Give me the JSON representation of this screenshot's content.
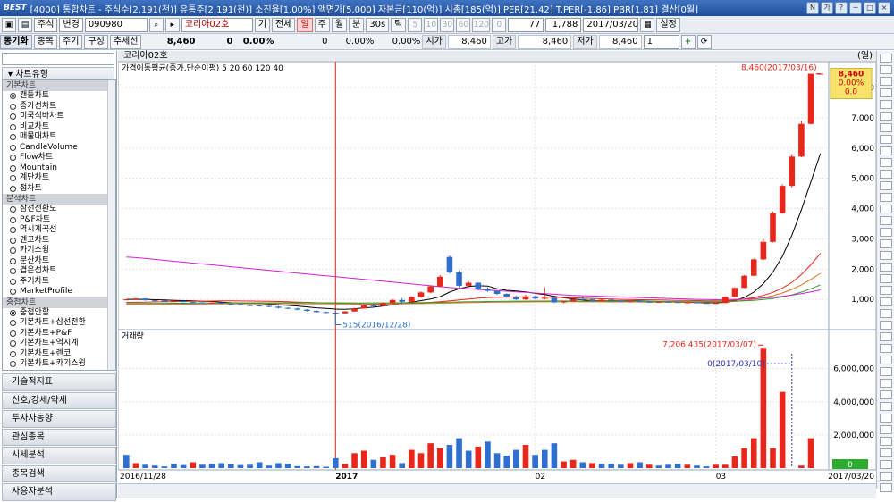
{
  "titlebar": {
    "logo": "BEST",
    "title": "[4000] 통합차트 - 주식수[2,191(천)] 유통주[2,191(천)] 소진율[1.00%] 액면가[5,000] 자본금[110(억)] 시총[185(억)] PER[21.42] T.PER[-1.86] PBR[1.81] 결산[0월]",
    "buttons": [
      "N",
      "가",
      "?",
      "─",
      "□",
      "×"
    ]
  },
  "toolbar": {
    "market": "주식",
    "change_label": "변경",
    "code": "090980",
    "stock_name": "코리아02호",
    "period_buttons": [
      "기",
      "전체",
      "일",
      "주",
      "월",
      "분",
      "30s",
      "틱"
    ],
    "interval_values": [
      "5",
      "10",
      "30",
      "60",
      "120",
      "0"
    ],
    "count": "77",
    "total": "1,788",
    "date": "2017/03/20",
    "settings_label": "설정"
  },
  "quote_row": {
    "link_label": "동기화",
    "tabs": [
      "종목",
      "주기",
      "구성",
      "추세선"
    ],
    "price": "8,460",
    "change": "0",
    "change_pct": "0.00%",
    "volume": "0",
    "vol_pct": "0.00%",
    "vol_pct2": "0.00%",
    "open_label": "시가",
    "open": "8,460",
    "high_label": "고가",
    "high": "8,460",
    "low_label": "저가",
    "low": "8,460",
    "combo_value": "1"
  },
  "left_panel": {
    "header": "차트유형",
    "groups": [
      {
        "name": "기본차트",
        "items": [
          "캔들차트",
          "종가선차트",
          "미국식바차트",
          "비교차트",
          "매물대차트",
          "CandleVolume",
          "Flow차트",
          "Mountain",
          "계단차트",
          "점차트"
        ],
        "selected": 0
      },
      {
        "name": "분석차트",
        "items": [
          "삼선전환도",
          "P&F차트",
          "역시계곡선",
          "렌코차트",
          "카기스윙",
          "분산차트",
          "겹은선차트",
          "주기차트",
          "MarketProfile"
        ],
        "selected": -1
      },
      {
        "name": "중첩차트",
        "items": [
          "중첩안함",
          "기본차트+삼선전환",
          "기본차트+P&F",
          "기본차트+역시계",
          "기본차트+렌코",
          "기본차트+카기스윙"
        ],
        "selected": 0
      }
    ],
    "menu": [
      "기술적지표",
      "신호/강세/약세",
      "투자자동향",
      "관심종목",
      "시세분석",
      "종목검색",
      "사용자분석"
    ]
  },
  "chart_header": {
    "name": "코리아02호",
    "unit": "(일)"
  },
  "colors": {
    "up": "#e8261a",
    "down": "#2f6fcf",
    "ma5": "#000000",
    "ma20": "#e8261a",
    "ma60": "#2e9e2e",
    "ma120": "#d020d0",
    "ma40": "#e07020"
  },
  "chart_data": [
    {
      "type": "candlestick",
      "title": "가격이동평균(종가,단순이평) 5 20 60 120 40",
      "legend": [
        "5",
        "20",
        "60",
        "120",
        "40"
      ],
      "x_ticks": [
        "2016/11/28",
        "2017",
        "02",
        "03",
        "2017/03/20"
      ],
      "ylim": [
        0,
        8800
      ],
      "y_ticks": [
        1000,
        2000,
        3000,
        4000,
        5000,
        6000,
        7000,
        8000
      ],
      "y_tick_labels": [
        "1,000",
        "2,000",
        "3,000",
        "4,000",
        "5,000",
        "6,000",
        "7,000",
        "8,000"
      ],
      "current_price": "8,460",
      "current_change": "0.00%",
      "current_diff": "0.0",
      "annotations": [
        {
          "text": "8,460(2017/03/16)",
          "index": 73,
          "value": 8460
        },
        {
          "text": "515(2016/12/28)",
          "index": 22,
          "value": 515
        }
      ],
      "candles": [
        [
          1000,
          1000,
          1000,
          1000
        ],
        [
          1000,
          1050,
          980,
          1030
        ],
        [
          1030,
          1040,
          960,
          970
        ],
        [
          970,
          990,
          940,
          960
        ],
        [
          960,
          980,
          930,
          940
        ],
        [
          940,
          960,
          920,
          950
        ],
        [
          950,
          960,
          900,
          910
        ],
        [
          910,
          930,
          880,
          900
        ],
        [
          900,
          910,
          870,
          880
        ],
        [
          880,
          900,
          860,
          890
        ],
        [
          890,
          900,
          850,
          860
        ],
        [
          860,
          880,
          830,
          840
        ],
        [
          840,
          850,
          800,
          810
        ],
        [
          810,
          830,
          780,
          800
        ],
        [
          800,
          820,
          760,
          780
        ],
        [
          780,
          800,
          740,
          760
        ],
        [
          760,
          780,
          700,
          720
        ],
        [
          720,
          740,
          680,
          700
        ],
        [
          700,
          720,
          640,
          660
        ],
        [
          660,
          680,
          600,
          620
        ],
        [
          620,
          640,
          560,
          580
        ],
        [
          580,
          600,
          540,
          560
        ],
        [
          560,
          600,
          515,
          540
        ],
        [
          540,
          620,
          530,
          600
        ],
        [
          600,
          720,
          590,
          700
        ],
        [
          700,
          820,
          690,
          800
        ],
        [
          800,
          860,
          760,
          780
        ],
        [
          780,
          900,
          770,
          880
        ],
        [
          880,
          1000,
          860,
          980
        ],
        [
          980,
          1050,
          900,
          920
        ],
        [
          920,
          1100,
          900,
          1080
        ],
        [
          1080,
          1260,
          1050,
          1230
        ],
        [
          1230,
          1450,
          1200,
          1430
        ],
        [
          1430,
          1800,
          1400,
          1750
        ],
        [
          2400,
          2450,
          1850,
          1900
        ],
        [
          1900,
          1950,
          1400,
          1450
        ],
        [
          1450,
          1600,
          1380,
          1550
        ],
        [
          1550,
          1560,
          1300,
          1330
        ],
        [
          1330,
          1400,
          1250,
          1280
        ],
        [
          1280,
          1300,
          1150,
          1180
        ],
        [
          1180,
          1200,
          1050,
          1080
        ],
        [
          1080,
          1120,
          980,
          1000
        ],
        [
          1000,
          1150,
          980,
          1100
        ],
        [
          1100,
          1120,
          1000,
          1030
        ],
        [
          1030,
          1400,
          1000,
          1050
        ],
        [
          1050,
          1080,
          880,
          900
        ],
        [
          900,
          960,
          870,
          940
        ],
        [
          940,
          1030,
          920,
          1010
        ],
        [
          1010,
          1100,
          980,
          1000
        ],
        [
          1000,
          1020,
          920,
          940
        ],
        [
          940,
          1000,
          930,
          990
        ],
        [
          990,
          1000,
          940,
          960
        ],
        [
          960,
          980,
          920,
          930
        ],
        [
          930,
          960,
          900,
          950
        ],
        [
          950,
          970,
          910,
          920
        ],
        [
          920,
          940,
          880,
          900
        ],
        [
          900,
          930,
          890,
          920
        ],
        [
          920,
          940,
          900,
          910
        ],
        [
          910,
          930,
          880,
          890
        ],
        [
          890,
          910,
          870,
          900
        ],
        [
          900,
          920,
          870,
          880
        ],
        [
          880,
          900,
          860,
          870
        ],
        [
          870,
          890,
          850,
          880
        ],
        [
          880,
          1100,
          870,
          1090
        ],
        [
          1090,
          1400,
          1080,
          1380
        ],
        [
          1380,
          1800,
          1370,
          1780
        ],
        [
          1780,
          2350,
          1770,
          2320
        ],
        [
          2320,
          3000,
          2300,
          2900
        ],
        [
          2900,
          3900,
          2880,
          3850
        ],
        [
          3850,
          4800,
          3830,
          4750
        ],
        [
          4750,
          5800,
          4700,
          5720
        ],
        [
          5720,
          6900,
          5700,
          6800
        ],
        [
          6800,
          8460,
          6780,
          8460
        ],
        [
          8460,
          8460,
          8460,
          8460
        ]
      ],
      "ma": {
        "5": [
          1000,
          1000,
          1000,
          990,
          980,
          970,
          960,
          950,
          940,
          930,
          910,
          890,
          880,
          870,
          860,
          840,
          820,
          800,
          780,
          750,
          720,
          700,
          680,
          670,
          690,
          720,
          740,
          780,
          820,
          870,
          910,
          960,
          1010,
          1090,
          1240,
          1350,
          1430,
          1450,
          1440,
          1350,
          1300,
          1280,
          1250,
          1200,
          1160,
          1100,
          1050,
          1020,
          980,
          960,
          950,
          950,
          950,
          950,
          950,
          940,
          930,
          920,
          910,
          900,
          895,
          890,
          885,
          900,
          960,
          1060,
          1240,
          1520,
          1900,
          2420,
          3120,
          3960,
          4880,
          5820
        ],
        "20": [
          900,
          905,
          910,
          915,
          920,
          925,
          930,
          935,
          940,
          945,
          950,
          950,
          948,
          945,
          942,
          938,
          930,
          920,
          910,
          900,
          890,
          880,
          870,
          860,
          850,
          845,
          842,
          845,
          850,
          860,
          870,
          885,
          900,
          920,
          950,
          980,
          1010,
          1040,
          1060,
          1070,
          1075,
          1080,
          1080,
          1078,
          1075,
          1070,
          1060,
          1050,
          1040,
          1030,
          1020,
          1010,
          1000,
          995,
          990,
          985,
          980,
          975,
          970,
          965,
          960,
          955,
          950,
          955,
          975,
          1010,
          1060,
          1130,
          1230,
          1370,
          1560,
          1820,
          2140,
          2520
        ],
        "60": [
          860,
          862,
          864,
          866,
          868,
          870,
          872,
          874,
          876,
          878,
          880,
          882,
          883,
          884,
          885,
          886,
          887,
          888,
          888,
          888,
          887,
          886,
          885,
          884,
          883,
          882,
          882,
          883,
          885,
          887,
          890,
          893,
          897,
          902,
          908,
          914,
          920,
          925,
          930,
          934,
          938,
          941,
          943,
          945,
          946,
          947,
          947,
          947,
          946,
          945,
          944,
          942,
          940,
          938,
          936,
          934,
          932,
          930,
          928,
          926,
          924,
          922,
          920,
          925,
          935,
          950,
          970,
          995,
          1030,
          1080,
          1150,
          1240,
          1350,
          1480
        ],
        "120": [
          2400,
          2380,
          2350,
          2320,
          2290,
          2260,
          2230,
          2200,
          2170,
          2140,
          2110,
          2080,
          2050,
          2020,
          1990,
          1960,
          1930,
          1900,
          1870,
          1840,
          1810,
          1780,
          1750,
          1720,
          1690,
          1660,
          1630,
          1600,
          1570,
          1540,
          1510,
          1480,
          1450,
          1420,
          1390,
          1370,
          1350,
          1330,
          1310,
          1290,
          1270,
          1250,
          1230,
          1210,
          1190,
          1170,
          1150,
          1130,
          1120,
          1110,
          1100,
          1090,
          1080,
          1070,
          1060,
          1050,
          1040,
          1030,
          1020,
          1010,
          1000,
          995,
          990,
          995,
          1000,
          1010,
          1025,
          1045,
          1070,
          1100,
          1140,
          1190,
          1250,
          1310
        ],
        "40": [
          830,
          832,
          834,
          836,
          838,
          840,
          842,
          844,
          846,
          848,
          850,
          851,
          852,
          853,
          854,
          855,
          855,
          855,
          855,
          854,
          853,
          852,
          851,
          850,
          849,
          848,
          848,
          849,
          851,
          853,
          856,
          860,
          865,
          871,
          878,
          885,
          892,
          898,
          903,
          907,
          911,
          914,
          916,
          918,
          919,
          920,
          920,
          920,
          919,
          918,
          917,
          916,
          915,
          914,
          913,
          912,
          911,
          910,
          909,
          908,
          907,
          906,
          905,
          915,
          935,
          965,
          1005,
          1055,
          1120,
          1210,
          1330,
          1480,
          1660,
          1860
        ]
      }
    },
    {
      "type": "bar",
      "title": "거래량",
      "ylim": [
        0,
        7600000
      ],
      "y_ticks": [
        2000000,
        4000000,
        6000000
      ],
      "y_tick_labels": [
        "2,000,000",
        "4,000,000",
        "6,000,000"
      ],
      "current_label": "0",
      "annotations": [
        {
          "text": "7,206,435(2017/03/07)",
          "index": 67,
          "value": 7206435
        },
        {
          "text": "0(2017/03/10)",
          "index": 70,
          "value": 0
        }
      ],
      "values": [
        800000,
        300000,
        200000,
        150000,
        100000,
        250000,
        180000,
        350000,
        200000,
        250000,
        300000,
        220000,
        180000,
        200000,
        350000,
        150000,
        300000,
        250000,
        120000,
        100000,
        120000,
        80000,
        600000,
        250000,
        900000,
        1050000,
        500000,
        650000,
        800000,
        300000,
        1100000,
        900000,
        1500000,
        1200000,
        1400000,
        1800000,
        1050000,
        1300000,
        1600000,
        900000,
        750000,
        1100000,
        1400000,
        800000,
        1100000,
        1500000,
        400000,
        500000,
        350000,
        300000,
        250000,
        250000,
        200000,
        300000,
        350000,
        200000,
        150000,
        200000,
        250000,
        200000,
        150000,
        100000,
        200000,
        200000,
        700000,
        1200000,
        1800000,
        7206435,
        1200000,
        4600000,
        0,
        150000,
        1800000,
        0
      ],
      "colors": [
        "down",
        "up",
        "down",
        "down",
        "down",
        "down",
        "down",
        "up",
        "down",
        "down",
        "down",
        "down",
        "down",
        "down",
        "down",
        "down",
        "down",
        "down",
        "down",
        "down",
        "down",
        "down",
        "down",
        "up",
        "up",
        "up",
        "down",
        "up",
        "up",
        "down",
        "up",
        "up",
        "up",
        "up",
        "down",
        "down",
        "down",
        "up",
        "down",
        "down",
        "down",
        "down",
        "up",
        "down",
        "down",
        "down",
        "up",
        "up",
        "down",
        "up",
        "down",
        "down",
        "down",
        "up",
        "down",
        "up",
        "down",
        "down",
        "down",
        "up",
        "down",
        "down",
        "up",
        "up",
        "up",
        "up",
        "up",
        "up",
        "up",
        "up",
        "up",
        "up",
        "up",
        "up"
      ]
    }
  ]
}
